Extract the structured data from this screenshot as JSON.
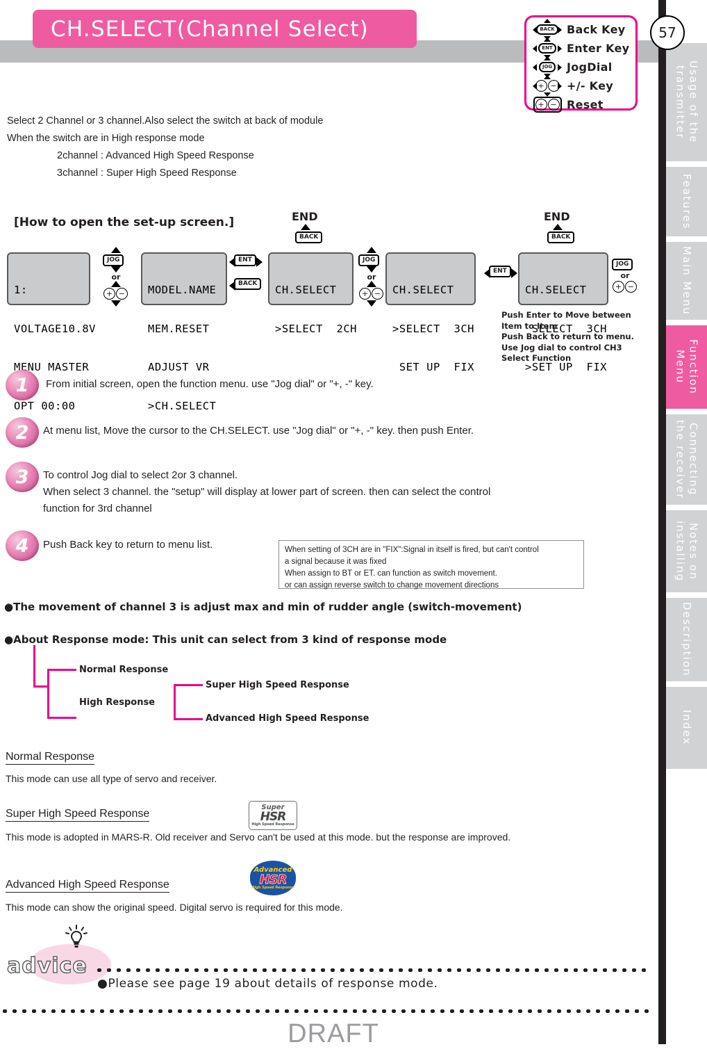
{
  "header": {
    "title": "CH.SELECT(Channel Select)",
    "page_number": "57",
    "legend": [
      {
        "icon": "back-key-icon",
        "cap": "BACK",
        "label": "Back Key"
      },
      {
        "icon": "enter-key-icon",
        "cap": "ENT",
        "label": "Enter Key"
      },
      {
        "icon": "jog-dial-icon",
        "cap": "JOG",
        "label": "JogDial"
      },
      {
        "icon": "plus-minus-key-icon",
        "cap": "+-",
        "label": "+/- Key"
      },
      {
        "icon": "reset-key-icon",
        "cap": "+-",
        "label": "Reset"
      }
    ]
  },
  "sidebar": {
    "tabs": [
      {
        "label": "Usage of the\ntransmitter",
        "active": false
      },
      {
        "label": "Features",
        "active": false
      },
      {
        "label": "Main Menu",
        "active": false
      },
      {
        "label": "Function Menu",
        "active": true
      },
      {
        "label": "Connecting\nthe receiver",
        "active": false
      },
      {
        "label": "Notes on\ninstalling",
        "active": false
      },
      {
        "label": "Description",
        "active": false
      },
      {
        "label": "Index",
        "active": false
      }
    ],
    "active_color": "#ef5ba1",
    "inactive_color": "#d0d2d3"
  },
  "intro": {
    "line1": "Select 2 Channel or 3 channel.Also select the switch at back of module",
    "line2": "When the switch are in High response mode",
    "line3": "2channel : Advanced High Speed Response",
    "line4": "3channel : Super High Speed Response"
  },
  "howto": {
    "heading": "[How to open the set-up screen.]",
    "end_label_1": "END",
    "end_label_2": "END",
    "screens": [
      {
        "name": "initial-screen",
        "lines": [
          "1:",
          "VOLTAGE10.8V",
          "MENU MASTER",
          "OPT 00:00"
        ]
      },
      {
        "name": "menu-list-screen",
        "lines": [
          "MODEL.NAME",
          "MEM.RESET",
          "ADJUST VR",
          ">CH.SELECT"
        ]
      },
      {
        "name": "chselect-2ch-screen",
        "lines": [
          "CH.SELECT",
          ">SELECT  2CH"
        ]
      },
      {
        "name": "chselect-3ch-screen",
        "lines": [
          "CH.SELECT",
          ">SELECT  3CH",
          " SET UP  FIX"
        ]
      },
      {
        "name": "chselect-setup-screen",
        "lines": [
          "CH.SELECT",
          " SELECT  3CH",
          ">SET UP  FIX"
        ]
      }
    ],
    "jog_label": "JOG",
    "or_label": "or",
    "ent_label": "ENT",
    "back_label": "BACK",
    "note": "Push Enter to Move between\nItem to Item\nPush Back to return to menu.\nUse Jog dial to control CH3\nSelect Function"
  },
  "steps": [
    {
      "num": "1",
      "text": "From initial screen, open the function menu. use \"Jog dial\" or \"+, -\" key."
    },
    {
      "num": "2",
      "text": "At menu list, Move the cursor to the CH.SELECT.  use \"Jog dial\" or \"+, -\" key. then push Enter."
    },
    {
      "num": "3",
      "text": "To control Jog dial to select 2or 3 channel.\nWhen select 3 channel. the \"setup\" will display at lower part of screen. then can select the control\nfunction for 3rd channel"
    },
    {
      "num": "4",
      "text": "Push Back key to return to menu list."
    }
  ],
  "notebox": {
    "line1": "When setting of 3CH are in \"FIX\":Signal in itself is fired, but can't control",
    "line2": "a signal because it was fixed",
    "line3": "When assign to BT or ET. can function as switch movement.",
    "line4": "or can assign reverse switch to change movement directions"
  },
  "bullets": {
    "b1": "The movement of channel 3 is adjust max and min of rudder angle (switch-movement)",
    "b2": "About Response mode: This unit can select from 3 kind of response mode"
  },
  "tree": {
    "normal": "Normal Response",
    "high": "High Response",
    "super": "Super High Speed Response",
    "advanced": "Advanced High Speed Response",
    "line_color": "#ec008c"
  },
  "descriptions": [
    {
      "heading": "Normal Response",
      "body": "This mode can use all type of servo and receiver.",
      "logo": null
    },
    {
      "heading": "Super High Speed Response",
      "body": "This mode is adopted in MARS-R. Old receiver and Servo can't be used at this mode. but the response are improved.",
      "logo": {
        "name": "super-hsr-logo",
        "top": "Super",
        "main": "HSR",
        "sub": "High Speed Response"
      }
    },
    {
      "heading": "Advanced High Speed Response",
      "body": "This mode can show the original speed. Digital servo is required for this mode.",
      "logo": {
        "name": "advanced-hsr-logo",
        "top": "Advanced",
        "main": "HSR",
        "sub": "High Speed Response"
      }
    }
  ],
  "advice": {
    "word": "advice",
    "text": "Please see page 19 about details of response mode."
  },
  "watermark": "DRAFT"
}
